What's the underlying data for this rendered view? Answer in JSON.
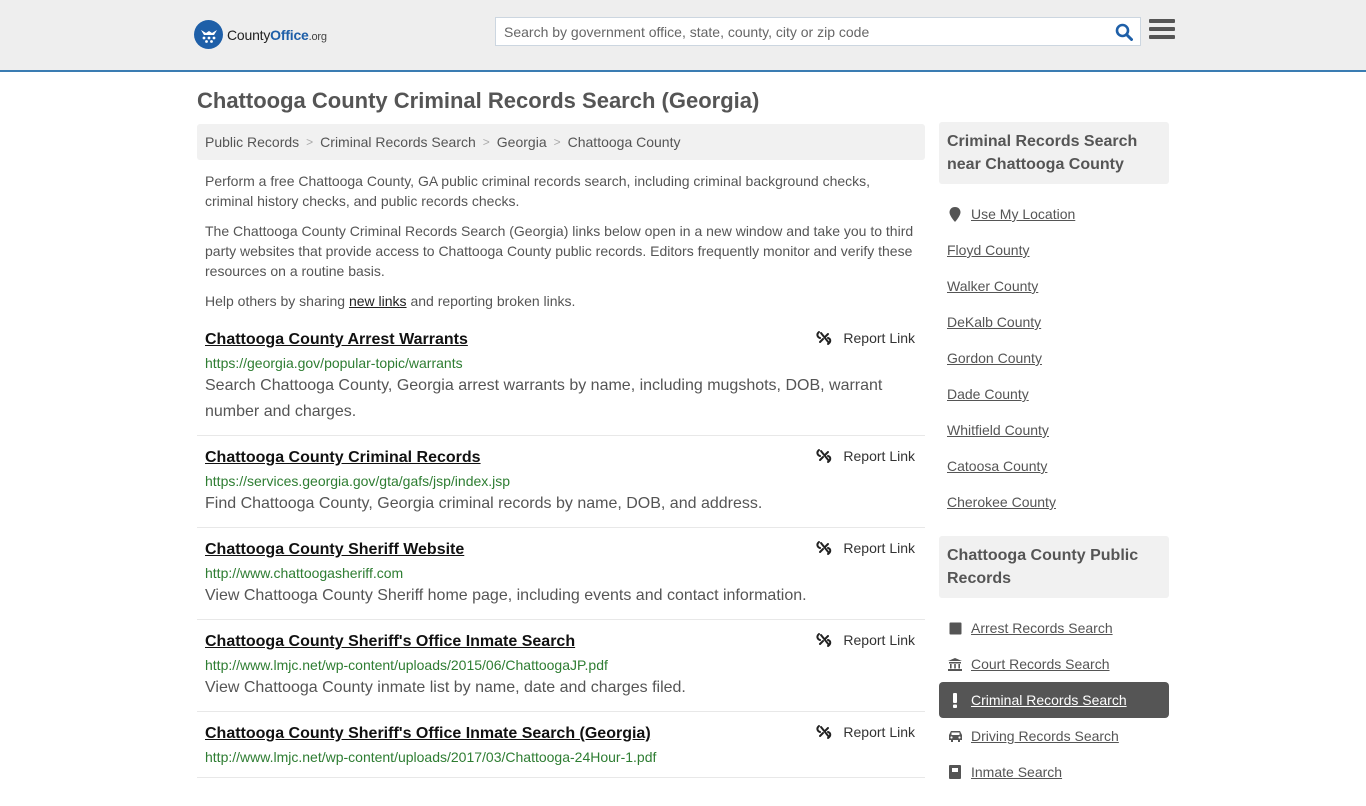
{
  "header": {
    "logo": {
      "part1": "County",
      "part2": "Office",
      "part3": ".org"
    },
    "search_placeholder": "Search by government office, state, county, city or zip code",
    "search_value": "",
    "accent_color": "#3a7cb2",
    "icons": {
      "search": "search-icon",
      "menu": "hamburger-menu-icon"
    }
  },
  "page": {
    "title": "Chattooga County Criminal Records Search (Georgia)"
  },
  "breadcrumb": [
    {
      "label": "Public Records"
    },
    {
      "label": "Criminal Records Search"
    },
    {
      "label": "Georgia"
    },
    {
      "label": "Chattooga County"
    }
  ],
  "intro": {
    "p1": "Perform a free Chattooga County, GA public criminal records search, including criminal background checks, criminal history checks, and public records checks.",
    "p2": "The Chattooga County Criminal Records Search (Georgia) links below open in a new window and take you to third party websites that provide access to Chattooga County public records. Editors frequently monitor and verify these resources on a routine basis.",
    "p3_before": "Help others by sharing ",
    "p3_link": "new links",
    "p3_after": " and reporting broken links."
  },
  "report_label": "Report Link",
  "results": [
    {
      "title": "Chattooga County Arrest Warrants",
      "url": "https://georgia.gov/popular-topic/warrants",
      "desc": "Search Chattooga County, Georgia arrest warrants by name, including mugshots, DOB, warrant number and charges."
    },
    {
      "title": "Chattooga County Criminal Records",
      "url": "https://services.georgia.gov/gta/gafs/jsp/index.jsp",
      "desc": "Find Chattooga County, Georgia criminal records by name, DOB, and address."
    },
    {
      "title": "Chattooga County Sheriff Website",
      "url": "http://www.chattoogasheriff.com",
      "desc": "View Chattooga County Sheriff home page, including events and contact information."
    },
    {
      "title": "Chattooga County Sheriff's Office Inmate Search",
      "url": "http://www.lmjc.net/wp-content/uploads/2015/06/ChattoogaJP.pdf",
      "desc": "View Chattooga County inmate list by name, date and charges filed."
    },
    {
      "title": "Chattooga County Sheriff's Office Inmate Search (Georgia)",
      "url": "http://www.lmjc.net/wp-content/uploads/2017/03/Chattooga-24Hour-1.pdf",
      "desc": ""
    }
  ],
  "sidebar": {
    "nearby_heading": "Criminal Records Search near Chattooga County",
    "use_location": "Use My Location",
    "nearby": [
      "Floyd County",
      "Walker County",
      "DeKalb County",
      "Gordon County",
      "Dade County",
      "Whitfield County",
      "Catoosa County",
      "Cherokee County"
    ],
    "public_heading": "Chattooga County Public Records",
    "public_records": [
      {
        "label": "Arrest Records Search",
        "icon": "square-icon",
        "active": false
      },
      {
        "label": "Court Records Search",
        "icon": "courthouse-icon",
        "active": false
      },
      {
        "label": "Criminal Records Search",
        "icon": "exclamation-icon",
        "active": true
      },
      {
        "label": "Driving Records Search",
        "icon": "car-icon",
        "active": false
      },
      {
        "label": "Inmate Search",
        "icon": "inmate-icon",
        "active": false
      }
    ]
  }
}
